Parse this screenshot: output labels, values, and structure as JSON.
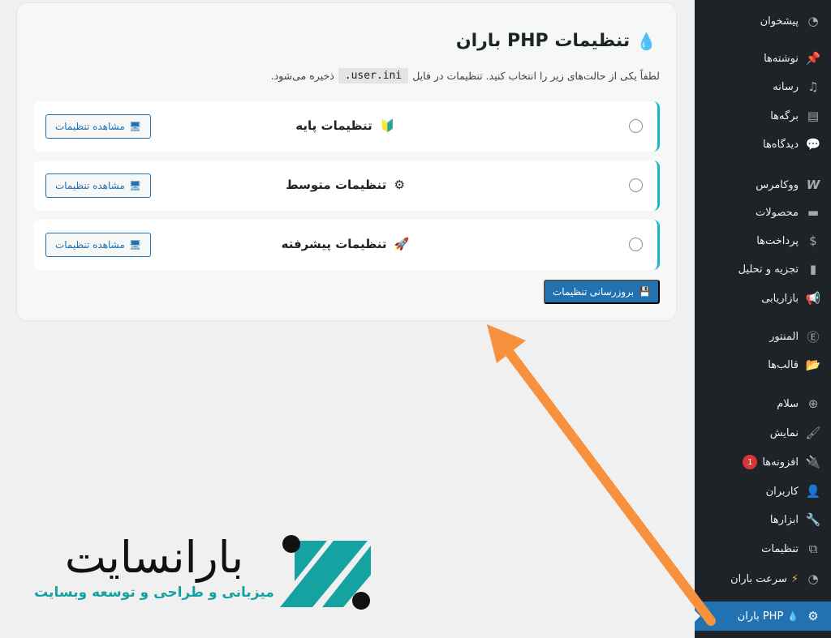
{
  "sidebar": {
    "items": [
      {
        "label": "پیشخوان",
        "icon": "dashboard-icon"
      },
      {
        "label": "نوشته‌ها",
        "icon": "pin-icon"
      },
      {
        "label": "رسانه",
        "icon": "media-icon"
      },
      {
        "label": "برگه‌ها",
        "icon": "pages-icon"
      },
      {
        "label": "دیدگاه‌ها",
        "icon": "comments-icon"
      },
      {
        "label": "ووکامرس",
        "icon": "woocommerce-icon"
      },
      {
        "label": "محصولات",
        "icon": "products-icon"
      },
      {
        "label": "پرداخت‌ها",
        "icon": "payments-icon"
      },
      {
        "label": "تجزیه و تحلیل",
        "icon": "analytics-icon"
      },
      {
        "label": "بازاریابی",
        "icon": "megaphone-icon"
      },
      {
        "label": "المنتور",
        "icon": "elementor-icon"
      },
      {
        "label": "قالب‌ها",
        "icon": "folder-icon"
      },
      {
        "label": "سلام",
        "icon": "plus-circle-icon"
      },
      {
        "label": "نمایش",
        "icon": "brush-icon"
      },
      {
        "label": "افزونه‌ها",
        "icon": "plugin-icon",
        "badge": "1"
      },
      {
        "label": "کاربران",
        "icon": "user-icon"
      },
      {
        "label": "ابزارها",
        "icon": "wrench-icon"
      },
      {
        "label": "تنظیمات",
        "icon": "settings-icon"
      },
      {
        "label": "سرعت باران",
        "icon": "speed-icon",
        "prefix": "⚡"
      },
      {
        "label": "PHP باران",
        "icon": "gear-icon",
        "prefix": "💧",
        "active": true
      }
    ]
  },
  "panel": {
    "title": "تنظیمات PHP باران",
    "desc_before": "لطفاً یکی از حالت‌های زیر را انتخاب کنید. تنظیمات در فایل",
    "desc_code": ".user.ini",
    "desc_after": "ذخیره می‌شود.",
    "options": [
      {
        "emoji": "🔰",
        "label": "تنظیمات پایه",
        "button": "مشاهده تنظیمات"
      },
      {
        "emoji": "⚙",
        "label": "تنظیمات متوسط",
        "button": "مشاهده تنظیمات"
      },
      {
        "emoji": "🚀",
        "label": "تنظیمات پیشرفته",
        "button": "مشاهده تنظیمات"
      }
    ],
    "update_button": "بروزرسانی تنظیمات"
  },
  "logo": {
    "name": "بارانسایت",
    "tagline": "میزبانی و طراحی و توسعه وبسایت"
  },
  "colors": {
    "sidebar_bg": "#1d2327",
    "accent": "#2271b1",
    "card_border": "#17b8c9",
    "arrow": "#f7913d",
    "logo_teal": "#17a2a2"
  }
}
